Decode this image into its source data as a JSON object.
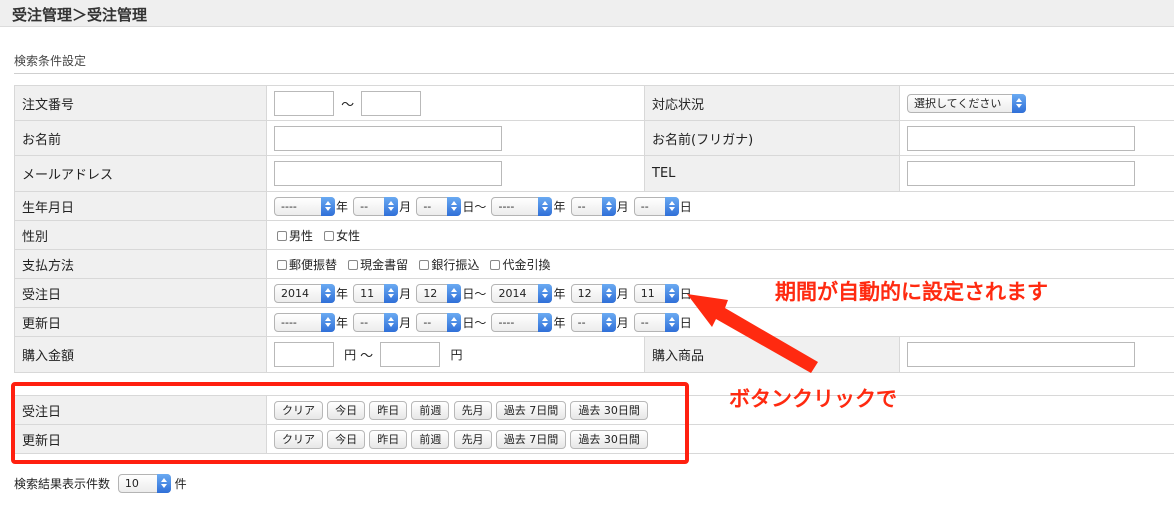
{
  "header": {
    "title": "受注管理＞受注管理"
  },
  "section": {
    "title": "検索条件設定"
  },
  "form": {
    "order_no": {
      "label": "注文番号",
      "tilde": "〜"
    },
    "status": {
      "label": "対応状況",
      "placeholder": "選択してください"
    },
    "name": {
      "label": "お名前"
    },
    "kana": {
      "label": "お名前(フリガナ)"
    },
    "email": {
      "label": "メールアドレス"
    },
    "tel": {
      "label": "TEL"
    },
    "birthday": {
      "label": "生年月日",
      "from": {
        "year": "----",
        "month": "--",
        "day": "--"
      },
      "to": {
        "year": "----",
        "month": "--",
        "day": "--"
      }
    },
    "gender": {
      "label": "性別",
      "options": [
        "男性",
        "女性"
      ]
    },
    "payment": {
      "label": "支払方法",
      "options": [
        "郵便振替",
        "現金書留",
        "銀行振込",
        "代金引換"
      ]
    },
    "order_date": {
      "label": "受注日",
      "from": {
        "year": "2014",
        "month": "11",
        "day": "12"
      },
      "to": {
        "year": "2014",
        "month": "12",
        "day": "11"
      }
    },
    "update_date": {
      "label": "更新日",
      "from": {
        "year": "----",
        "month": "--",
        "day": "--"
      },
      "to": {
        "year": "----",
        "month": "--",
        "day": "--"
      }
    },
    "amount": {
      "label": "購入金額",
      "unit": "円",
      "tilde": "〜"
    },
    "product": {
      "label": "購入商品"
    },
    "units": {
      "year": "年",
      "month": "月",
      "day": "日",
      "range": "日〜"
    }
  },
  "quick": {
    "rows": [
      {
        "label": "受注日"
      },
      {
        "label": "更新日"
      }
    ],
    "buttons": [
      "クリア",
      "今日",
      "昨日",
      "前週",
      "先月",
      "過去 7日間",
      "過去 30日間"
    ]
  },
  "results": {
    "label": "検索結果表示件数",
    "value": "10",
    "unit": "件"
  },
  "annotations": {
    "auto_period": "期間が自動的に設定されます",
    "button_click": "ボタンクリックで",
    "color": "#ff2a10"
  }
}
